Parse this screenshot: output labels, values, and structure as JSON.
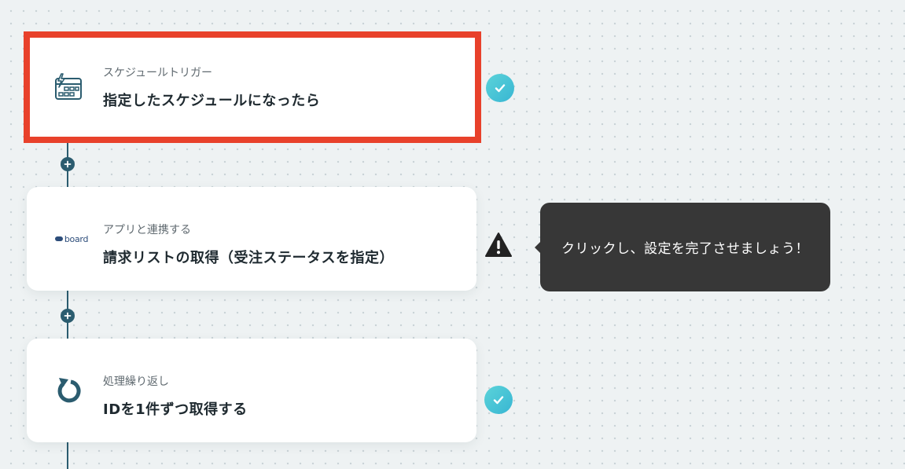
{
  "steps": [
    {
      "subtitle": "スケジュールトリガー",
      "title": "指定したスケジュールになったら",
      "icon": "schedule-trigger-icon",
      "status": "complete",
      "selected": true
    },
    {
      "subtitle": "アプリと連携する",
      "title": "請求リストの取得（受注ステータスを指定）",
      "icon": "board-app-logo",
      "logo_text": "board",
      "status": "warning",
      "selected": false
    },
    {
      "subtitle": "処理繰り返し",
      "title": "IDを1件ずつ取得する",
      "icon": "loop-icon",
      "status": "complete",
      "selected": false
    }
  ],
  "tooltip": {
    "text": "クリックし、設定を完了させましょう！"
  },
  "colors": {
    "accent_highlight": "#e8412b",
    "flow_line": "#2b5c6f",
    "check_badge": "#45c3d6",
    "tooltip_bg": "#373737",
    "canvas_bg": "#eef2f3"
  }
}
